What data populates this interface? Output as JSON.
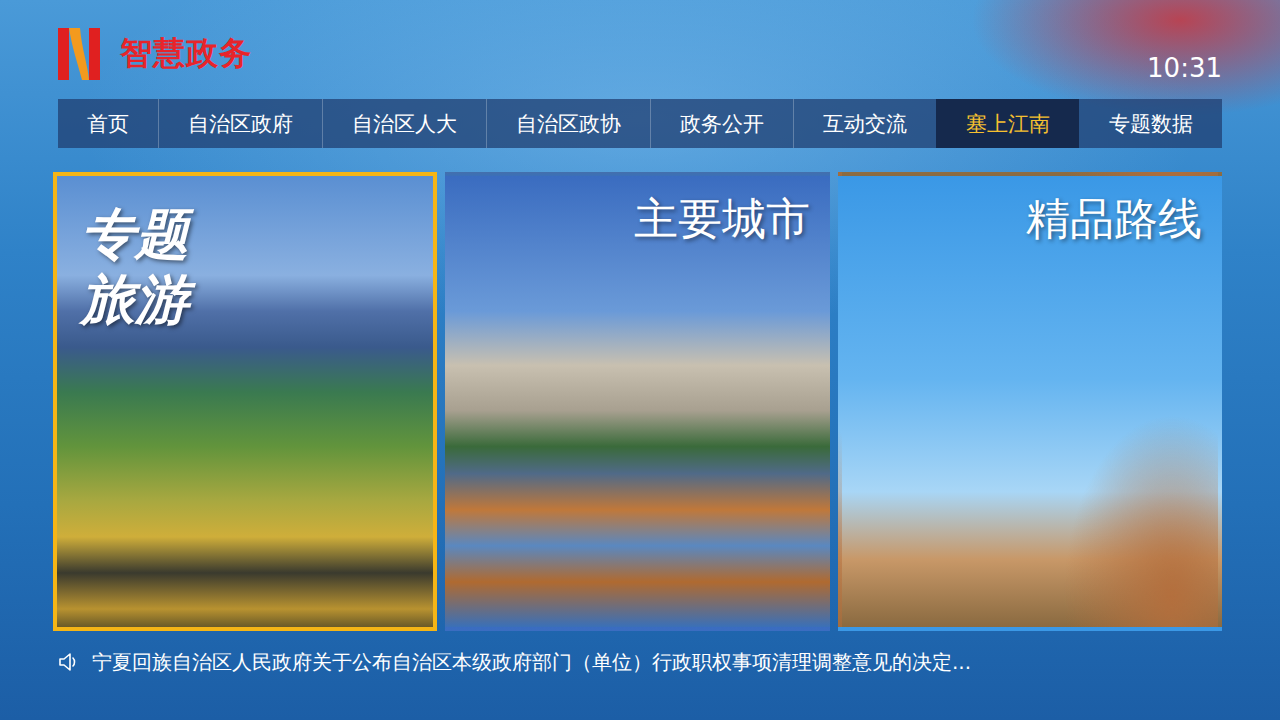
{
  "header": {
    "logo_text": "智慧政务",
    "time": "10:31"
  },
  "nav": [
    {
      "label": "首页",
      "selected": false
    },
    {
      "label": "自治区政府",
      "selected": false
    },
    {
      "label": "自治区人大",
      "selected": false
    },
    {
      "label": "自治区政协",
      "selected": false
    },
    {
      "label": "政务公开",
      "selected": false
    },
    {
      "label": "互动交流",
      "selected": false
    },
    {
      "label": "塞上江南",
      "selected": true
    },
    {
      "label": "专题数据",
      "selected": false
    }
  ],
  "cards": [
    {
      "title": "专题旅游",
      "kind": "calligraphy",
      "focused": true
    },
    {
      "title": "主要城市",
      "kind": "plain",
      "focused": false
    },
    {
      "title": "精品路线",
      "kind": "plain",
      "focused": false
    }
  ],
  "ticker": {
    "text": "宁夏回族自治区人民政府关于公布自治区本级政府部门（单位）行政职权事项清理调整意见的决定..."
  }
}
